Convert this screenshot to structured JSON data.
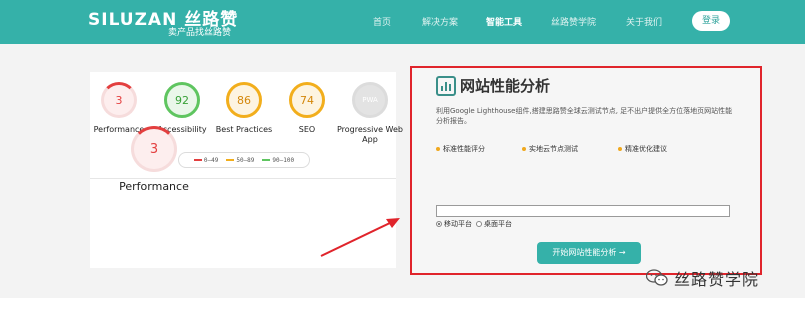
{
  "header": {
    "logo": "SILUZAN 丝路赞",
    "slogan": "卖产品找丝路赞",
    "nav": [
      {
        "label": "首页"
      },
      {
        "label": "解决方案"
      },
      {
        "label": "智能工具",
        "active": true
      },
      {
        "label": "丝路赞学院"
      },
      {
        "label": "关于我们"
      }
    ],
    "login": "登录",
    "bg_color": "#35b1a9"
  },
  "report": {
    "gauges": [
      {
        "score": "3",
        "label": "Performance",
        "status": "red"
      },
      {
        "score": "92",
        "label": "Accessibility",
        "status": "green"
      },
      {
        "score": "86",
        "label": "Best Practices",
        "status": "orange"
      },
      {
        "score": "74",
        "label": "SEO",
        "status": "orange"
      },
      {
        "score": "PWA",
        "label": "Progressive Web App",
        "status": "gray"
      }
    ],
    "legend": [
      {
        "range": "0–49",
        "color": "#e33f3f"
      },
      {
        "range": "50–89",
        "color": "#f2ae1c"
      },
      {
        "range": "90–100",
        "color": "#5fc560"
      }
    ],
    "main_score": "3",
    "main_label": "Performance"
  },
  "panel": {
    "title": "网站性能分析",
    "description": "利用Google Lighthouse组件,搭建思路赞全球云测试节点, 足不出户提供全方位落地页网站性能分析报告。",
    "features": [
      "标准性能评分",
      "实地云节点测试",
      "精准优化建议"
    ],
    "url_value": "",
    "radios": [
      {
        "label": "移动平台",
        "checked": true
      },
      {
        "label": "桌面平台",
        "checked": false
      }
    ],
    "start_button": "开始网站性能分析 →",
    "border_color": "#e0242b"
  },
  "watermark": {
    "text": "丝路赞学院",
    "icon": "wechat-icon"
  }
}
